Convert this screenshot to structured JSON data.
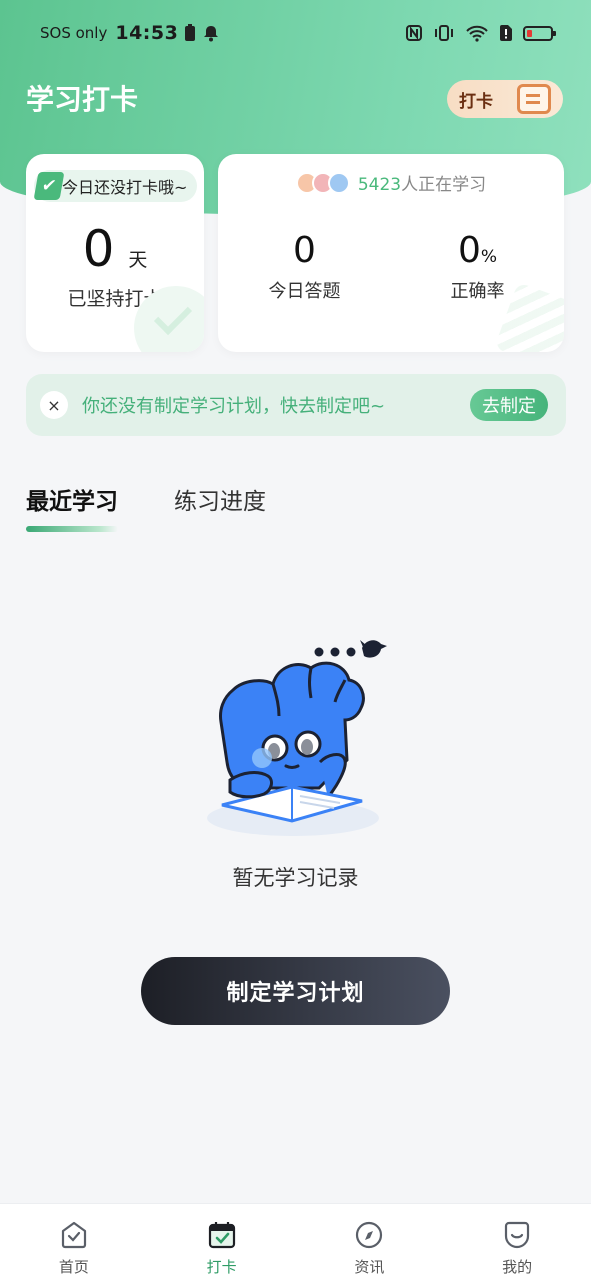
{
  "status": {
    "carrier": "SOS only",
    "time": "14:53"
  },
  "header": {
    "title": "学习打卡",
    "badge_label": "打卡"
  },
  "checkin_card": {
    "tag": "今日还没打卡哦~",
    "days": "0",
    "days_unit": "天",
    "label": "已坚持打卡"
  },
  "stats_card": {
    "learner_count": "5423",
    "learner_suffix": "人正在学习",
    "answered_value": "0",
    "answered_label": "今日答题",
    "accuracy_value": "0",
    "accuracy_unit": "%",
    "accuracy_label": "正确率"
  },
  "plan_banner": {
    "close_glyph": "×",
    "text": "你还没有制定学习计划，快去制定吧~",
    "button": "去制定"
  },
  "tabs": [
    {
      "label": "最近学习",
      "active": true
    },
    {
      "label": "练习进度",
      "active": false
    }
  ],
  "empty_state": {
    "text": "暂无学习记录"
  },
  "cta": {
    "label": "制定学习计划"
  },
  "bottom_nav": [
    {
      "label": "首页",
      "icon": "home-icon",
      "active": false
    },
    {
      "label": "打卡",
      "icon": "calendar-check-icon",
      "active": true
    },
    {
      "label": "资讯",
      "icon": "compass-icon",
      "active": false
    },
    {
      "label": "我的",
      "icon": "profile-icon",
      "active": false
    }
  ],
  "colors": {
    "accent": "#4ab97c",
    "header_gradient_start": "#5cc490",
    "header_gradient_end": "#8fe0bd",
    "cta_dark": "#1d1f26"
  }
}
